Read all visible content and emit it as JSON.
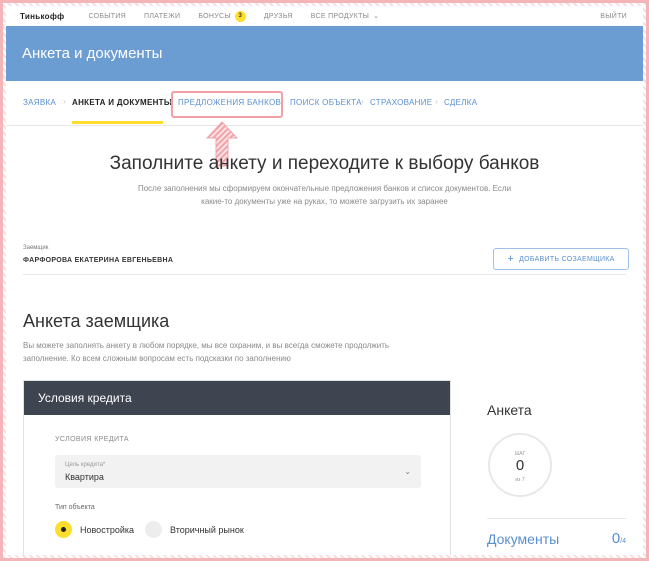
{
  "topnav": {
    "logo": "Тинькофф",
    "items": [
      "События",
      "Платежи",
      "Бонусы",
      "Друзья",
      "Все продукты"
    ],
    "bonus_count": "3",
    "logout": "Выйти"
  },
  "header": {
    "title": "Анкета и документы"
  },
  "steps": [
    "Заявка",
    "Анкета и документы",
    "Предложения банков",
    "Поиск объекта",
    "Страхование",
    "Сделка"
  ],
  "hero": {
    "title": "Заполните анкету и переходите к выбору банков",
    "subtitle": "После заполнения мы сформируем окончательные предложения банков и список документов. Если какие-то документы уже на руках, то можете загрузить их заранее"
  },
  "borrower": {
    "label": "Заемщик",
    "name": "ФАРФОРОВА ЕКАТЕРИНА ЕВГЕНЬЕВНА",
    "add_coborrower": "Добавить созаемщика"
  },
  "form": {
    "title": "Анкета заемщика",
    "subtitle": "Вы можете заполнять анкету в любом порядке, мы все охраним, и вы всегда сможете продолжить заполнение. Ко всем сложным вопросам есть подсказки по заполнению",
    "card_title": "Условия кредита",
    "section_label": "Условия кредита",
    "purpose_label": "Цель кредита*",
    "purpose_value": "Квартира",
    "object_type_label": "Тип объекта",
    "options": [
      "Новостройка",
      "Вторичный рынок"
    ],
    "selected_option": "Новостройка"
  },
  "side": {
    "title": "Анкета",
    "step_label": "Шаг",
    "step_value": "0",
    "step_of": "из 7",
    "docs_label": "Документы",
    "docs_count": "0",
    "docs_total": "/4"
  },
  "colors": {
    "accent_yellow": "#ffdd2d",
    "header_blue": "#6b9dd3",
    "link_blue": "#5a8fd0",
    "card_header": "#3e4450",
    "annotation_pink": "#f1a0a5"
  }
}
